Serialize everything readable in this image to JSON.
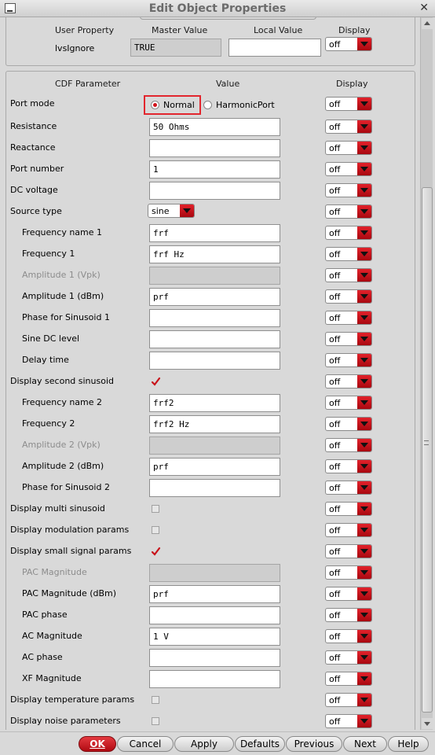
{
  "window": {
    "title": "Edit Object Properties"
  },
  "user_prop": {
    "headers": [
      "User Property",
      "Master Value",
      "Local Value",
      "Display"
    ],
    "name": "lvsIgnore",
    "master_value": "TRUE",
    "local_value": "",
    "display": "off"
  },
  "cdf": {
    "headers": [
      "CDF Parameter",
      "Value",
      "Display"
    ],
    "port_mode": {
      "label": "Port mode",
      "options": [
        "Normal",
        "HarmonicPort"
      ],
      "selected": "Normal",
      "display": "off"
    },
    "rows": [
      {
        "label": "Resistance",
        "value": "50 Ohms",
        "display": "off"
      },
      {
        "label": "Reactance",
        "value": "",
        "display": "off"
      },
      {
        "label": "Port number",
        "value": "1",
        "display": "off"
      },
      {
        "label": "DC voltage",
        "value": "",
        "display": "off"
      },
      {
        "label": "Source type",
        "value": "sine",
        "display": "off"
      },
      {
        "label": "Frequency name 1",
        "value": "frf",
        "display": "off"
      },
      {
        "label": "Frequency 1",
        "value": "frf Hz",
        "display": "off"
      },
      {
        "label": "Amplitude 1 (Vpk)",
        "value": "",
        "display": "off"
      },
      {
        "label": "Amplitude 1 (dBm)",
        "value": "prf",
        "display": "off"
      },
      {
        "label": "Phase for Sinusoid 1",
        "value": "",
        "display": "off"
      },
      {
        "label": "Sine DC level",
        "value": "",
        "display": "off"
      },
      {
        "label": "Delay time",
        "value": "",
        "display": "off"
      },
      {
        "label": "Display second sinusoid",
        "checked": true,
        "display": "off"
      },
      {
        "label": "Frequency name 2",
        "value": "frf2",
        "display": "off"
      },
      {
        "label": "Frequency 2",
        "value": "frf2 Hz",
        "display": "off"
      },
      {
        "label": "Amplitude 2 (Vpk)",
        "value": "",
        "display": "off"
      },
      {
        "label": "Amplitude 2 (dBm)",
        "value": "prf",
        "display": "off"
      },
      {
        "label": "Phase for Sinusoid 2",
        "value": "",
        "display": "off"
      },
      {
        "label": "Display multi sinusoid",
        "checked": false,
        "display": "off"
      },
      {
        "label": "Display modulation params",
        "checked": false,
        "display": "off"
      },
      {
        "label": "Display small signal params",
        "checked": true,
        "display": "off"
      },
      {
        "label": "PAC Magnitude",
        "value": "",
        "display": "off"
      },
      {
        "label": "PAC Magnitude (dBm)",
        "value": "prf",
        "display": "off"
      },
      {
        "label": "PAC phase",
        "value": "",
        "display": "off"
      },
      {
        "label": "AC Magnitude",
        "value": "1 V",
        "display": "off"
      },
      {
        "label": "AC phase",
        "value": "",
        "display": "off"
      },
      {
        "label": "XF Magnitude",
        "value": "",
        "display": "off"
      },
      {
        "label": "Display temperature params",
        "checked": false,
        "display": "off"
      },
      {
        "label": "Display noise parameters",
        "checked": false,
        "display": "off"
      }
    ]
  },
  "buttons": {
    "ok": "OK",
    "cancel": "Cancel",
    "apply": "Apply",
    "defaults": "Defaults",
    "previous": "Previous",
    "next": "Next",
    "help": "Help"
  },
  "colors": {
    "accent_red": "#d2141c",
    "highlight_box": "#e2262e"
  }
}
